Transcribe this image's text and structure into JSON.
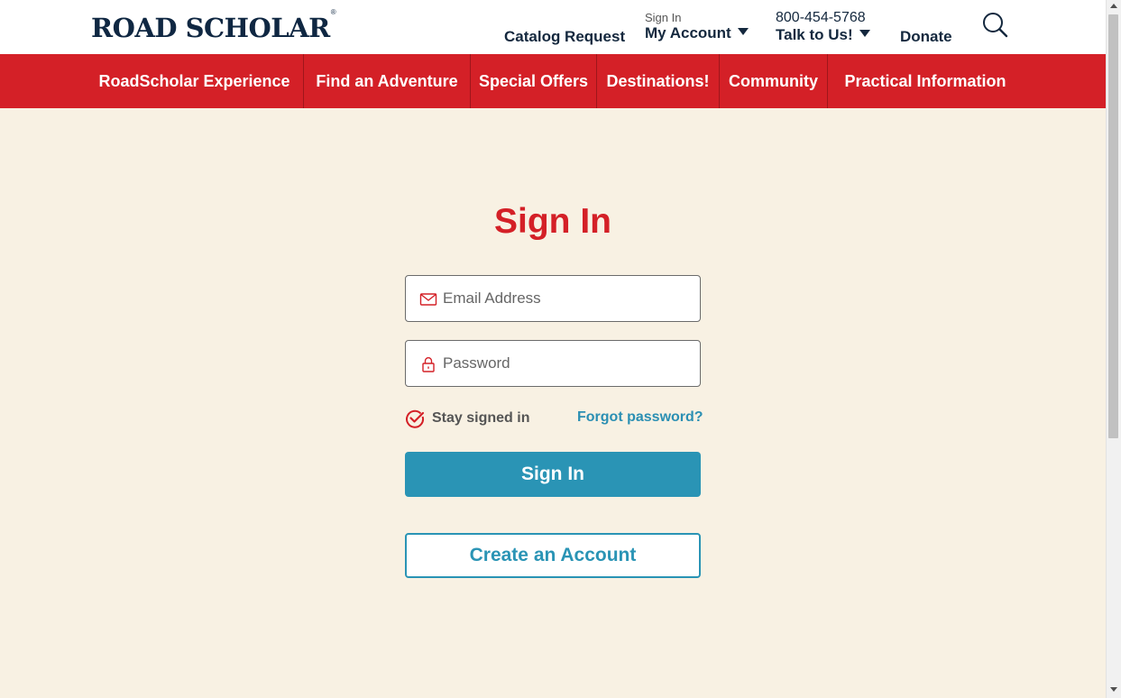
{
  "header": {
    "logo_text": "ROAD SCHOLAR",
    "logo_mark": "®",
    "catalog_request": "Catalog Request",
    "sign_in_small": "Sign In",
    "my_account": "My Account",
    "phone": "800-454-5768",
    "talk_to_us": "Talk to Us!",
    "donate": "Donate",
    "search_icon": "search-icon"
  },
  "nav": {
    "items": [
      {
        "label": "RoadScholar Experience"
      },
      {
        "label": "Find an Adventure"
      },
      {
        "label": "Special Offers"
      },
      {
        "label": "Destinations!"
      },
      {
        "label": "Community"
      },
      {
        "label": "Practical Information"
      }
    ]
  },
  "form": {
    "title": "Sign In",
    "email_placeholder": "Email Address",
    "email_value": "",
    "password_placeholder": "Password",
    "password_value": "",
    "stay_signed_in": "Stay signed in",
    "stay_signed_in_checked": true,
    "forgot_password": "Forgot password?",
    "sign_in_button": "Sign In",
    "create_account_button": "Create an Account"
  },
  "colors": {
    "brand_red": "#d42027",
    "brand_navy": "#0f2742",
    "accent_teal": "#2a94b5",
    "page_bg": "#f8f1e3"
  }
}
